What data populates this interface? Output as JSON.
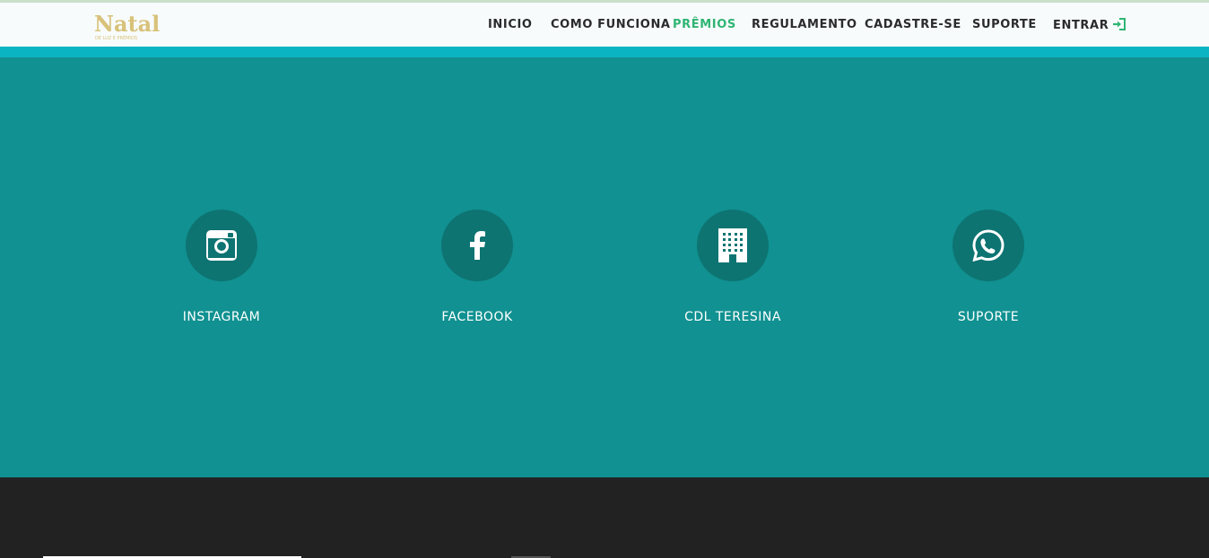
{
  "header": {
    "logo": {
      "title": "Natal",
      "subtitle": "DE LUZ E PRÊMIOS"
    },
    "nav": [
      {
        "label": "INICIO",
        "active": false
      },
      {
        "label": "COMO FUNCIONA",
        "active": false
      },
      {
        "label": "PRÊMIOS",
        "active": true
      },
      {
        "label": "REGULAMENTO",
        "active": false
      },
      {
        "label": "CADASTRE-SE",
        "active": false
      },
      {
        "label": "SUPORTE",
        "active": false
      },
      {
        "label": "ENTRAR",
        "active": false,
        "icon": "sign-in-icon"
      }
    ]
  },
  "social": [
    {
      "label": "INSTAGRAM",
      "icon": "instagram-icon"
    },
    {
      "label": "FACEBOOK",
      "icon": "facebook-icon"
    },
    {
      "label": "CDL TERESINA",
      "icon": "building-icon"
    },
    {
      "label": "SUPORTE",
      "icon": "whatsapp-icon"
    }
  ],
  "colors": {
    "accent_green": "#2fb574",
    "teal_section": "#119191",
    "teal_strip": "#0bb4c2",
    "circle": "#0d7472",
    "footer": "#222222",
    "logo_gold": "#d8c27a"
  }
}
